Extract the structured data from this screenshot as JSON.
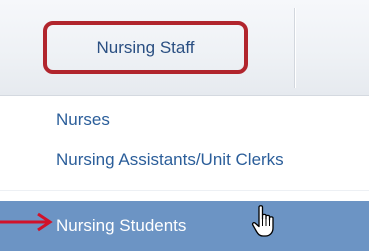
{
  "nav": {
    "tab_label": "Nursing Staff"
  },
  "dropdown": {
    "items": [
      {
        "label": "Nurses"
      },
      {
        "label": "Nursing Assistants/Unit Clerks"
      },
      {
        "label": "Nursing Students"
      }
    ]
  },
  "icons": {
    "pointer": "hand-pointer-icon",
    "annotation": "arrow-right-icon"
  },
  "colors": {
    "highlight_border": "#b1252d",
    "link": "#2b5e9a",
    "selected_bg": "#6c94c4",
    "selected_text": "#ffffff",
    "arrow": "#d1122a"
  }
}
